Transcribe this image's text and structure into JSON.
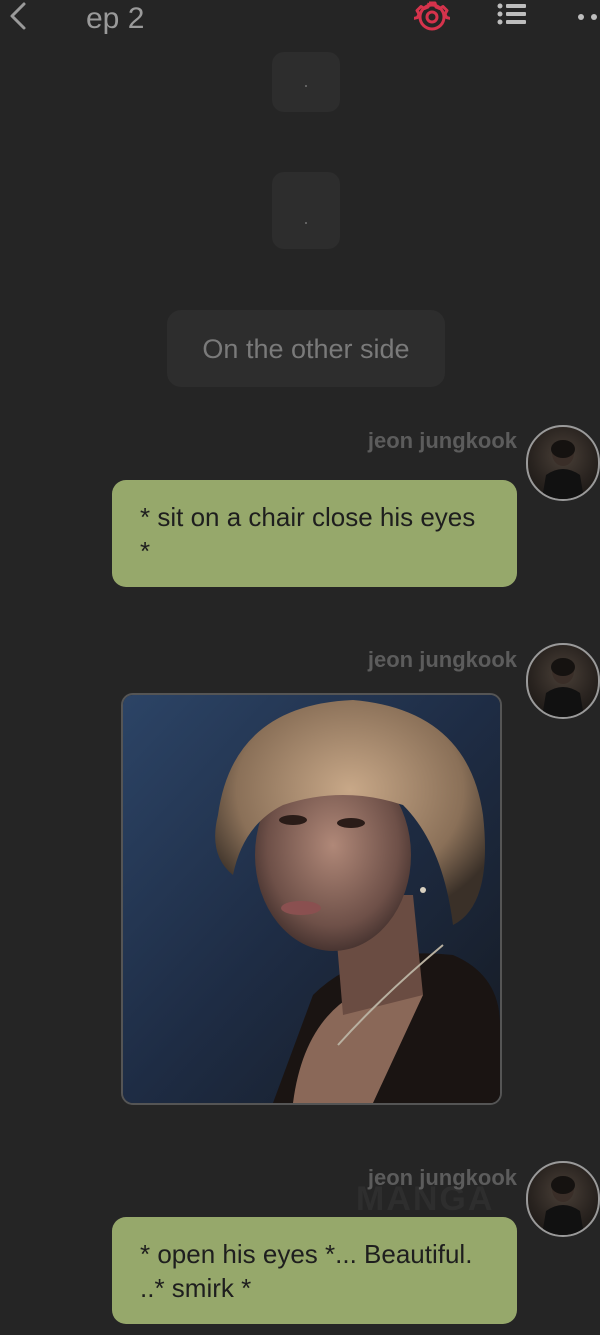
{
  "header": {
    "title": "ep 2",
    "back_icon": "chevron-left-icon",
    "settings_icon": "gear-icon",
    "list_icon": "list-icon",
    "more_icon": "more-dots-icon",
    "accent_color": "#d6334c"
  },
  "story": {
    "narration_1": ".",
    "narration_2": ".",
    "scene_caption": "On the other side"
  },
  "messages": [
    {
      "sender": "jeon jungkook",
      "text": "* sit on a chair close his eyes *"
    },
    {
      "sender": "jeon jungkook",
      "type": "image"
    },
    {
      "sender": "jeon jungkook",
      "text": "* open his eyes *... Beautiful. ..* smirk *"
    }
  ],
  "watermark": "MANGA",
  "colors": {
    "background": "#252525",
    "bubble": "#96a86b",
    "narration_bubble": "#2d2d2d"
  }
}
